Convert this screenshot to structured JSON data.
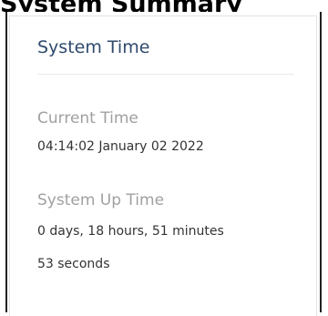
{
  "header": {
    "partial_title": "System Summary"
  },
  "system_time": {
    "title": "System Time",
    "current_time_label": "Current Time",
    "current_time_value": "04:14:02 January 02 2022",
    "uptime_label": "System Up Time",
    "uptime_value_line1": "0 days, 18 hours, 51 minutes",
    "uptime_value_line2": "53 seconds"
  },
  "colors": {
    "title": "#2f4a6d",
    "label": "#a0a0a0",
    "value": "#333333",
    "border": "#e3e3e3"
  }
}
